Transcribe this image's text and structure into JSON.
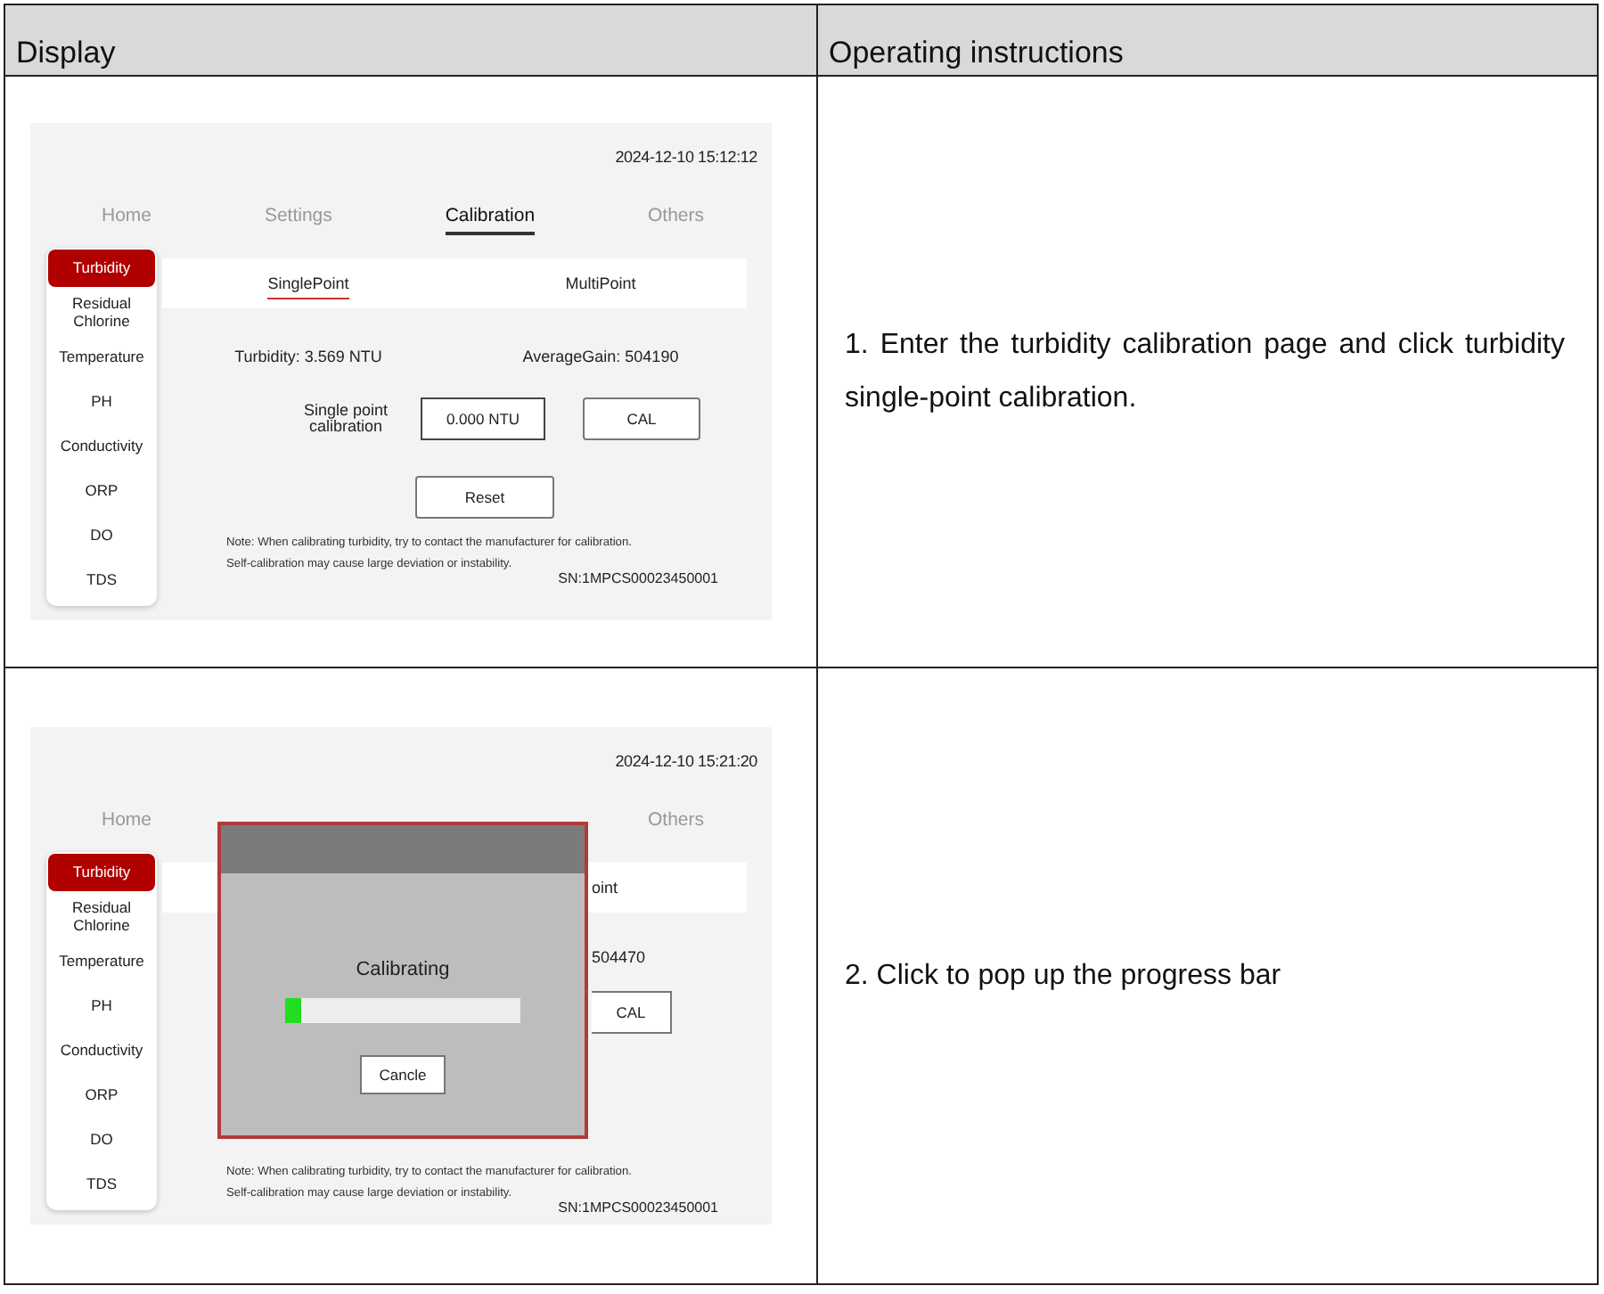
{
  "table": {
    "columns": [
      "Display",
      "Operating instructions"
    ],
    "rows": [
      {
        "screen": {
          "kind": "calibration",
          "date": "2024-12-10 15:12:12",
          "tabs": [
            {
              "label": "Home",
              "selected": false
            },
            {
              "label": "Settings",
              "selected": false
            },
            {
              "label": "Calibration",
              "selected": true
            },
            {
              "label": "Others",
              "selected": false
            }
          ],
          "sidebar": [
            {
              "label": "Turbidity",
              "selected": true
            },
            {
              "label": "Residual Chlorine",
              "selected": false
            },
            {
              "label": "Temperature",
              "selected": false
            },
            {
              "label": "PH",
              "selected": false
            },
            {
              "label": "Conductivity",
              "selected": false
            },
            {
              "label": "ORP",
              "selected": false
            },
            {
              "label": "DO",
              "selected": false
            },
            {
              "label": "TDS",
              "selected": false
            }
          ],
          "subtabs": [
            {
              "label": "SinglePoint",
              "selected": true
            },
            {
              "label": "MultiPoint",
              "selected": false
            }
          ],
          "readings": [
            "Turbidity: 3.569 NTU",
            "AverageGain: 504190"
          ],
          "calibration_label": "Single point calibration",
          "value_field": "0.000 NTU",
          "cal_button": "CAL",
          "reset_button": "Reset",
          "note": "Note: When calibrating turbidity, try to contact the manufacturer for calibration.\nSelf-calibration may cause large deviation or instability.",
          "serial": "SN:1MPCS00023450001"
        },
        "instruction": "1. Enter the turbidity calibration page and click turbidity single-point calibration."
      },
      {
        "screen": {
          "kind": "progress",
          "date": "2024-12-10 15:21:20",
          "tabs": [
            {
              "label": "Home",
              "selected": false
            },
            {
              "label": "Others",
              "selected": false
            }
          ],
          "sidebar": [
            {
              "label": "Turbidity",
              "selected": true
            },
            {
              "label": "Residual Chlorine",
              "selected": false
            },
            {
              "label": "Temperature",
              "selected": false
            },
            {
              "label": "PH",
              "selected": false
            },
            {
              "label": "Conductivity",
              "selected": false
            },
            {
              "label": "ORP",
              "selected": false
            },
            {
              "label": "DO",
              "selected": false
            },
            {
              "label": "TDS",
              "selected": false
            }
          ],
          "subtab_fragment": "oint",
          "reading_fragment": "504470",
          "cal_button": "CAL",
          "note": "Note: When calibrating turbidity, try to contact the manufacturer for calibration.\nSelf-calibration may cause large deviation or instability.",
          "serial": "SN:1MPCS00023450001",
          "dialog": {
            "message": "Calibrating",
            "level": 0.07,
            "button": "Cancle"
          }
        },
        "instruction": "2. Click to pop up the progress bar"
      }
    ]
  }
}
